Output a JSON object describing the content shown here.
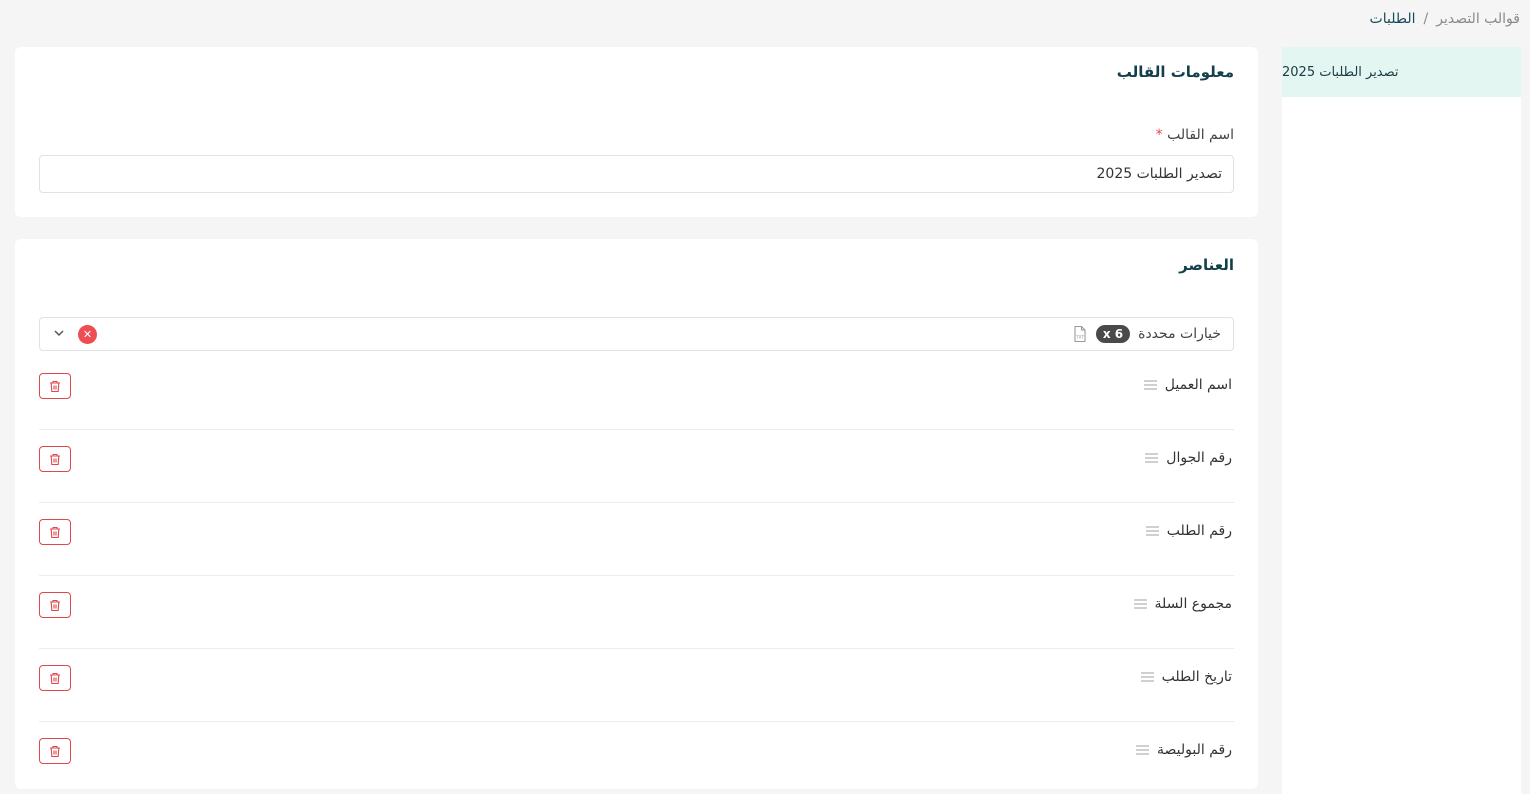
{
  "breadcrumb": {
    "root": "الطلبات",
    "separator": "/",
    "current": "قوالب التصدير"
  },
  "sidebar": {
    "items": [
      {
        "label": "تصدير الطلبات 2025",
        "active": true
      }
    ]
  },
  "template_info": {
    "title": "معلومات القالب",
    "name_label": "اسم القالب",
    "required_mark": "*",
    "name_value": "تصدير الطلبات 2025"
  },
  "elements": {
    "title": "العناصر",
    "select": {
      "count_badge": "x 6",
      "text": "خيارات محددة",
      "clear_icon": "close-icon",
      "toggle_icon": "chevron-down-icon"
    },
    "items": [
      {
        "label": "اسم العميل"
      },
      {
        "label": "رقم الجوال"
      },
      {
        "label": "رقم الطلب"
      },
      {
        "label": "مجموع السلة"
      },
      {
        "label": "تاريخ الطلب"
      },
      {
        "label": "رقم البوليصة"
      }
    ]
  },
  "colors": {
    "accent": "#14404c",
    "active_item_bg": "#e4f6f1",
    "danger": "#e5484d"
  }
}
